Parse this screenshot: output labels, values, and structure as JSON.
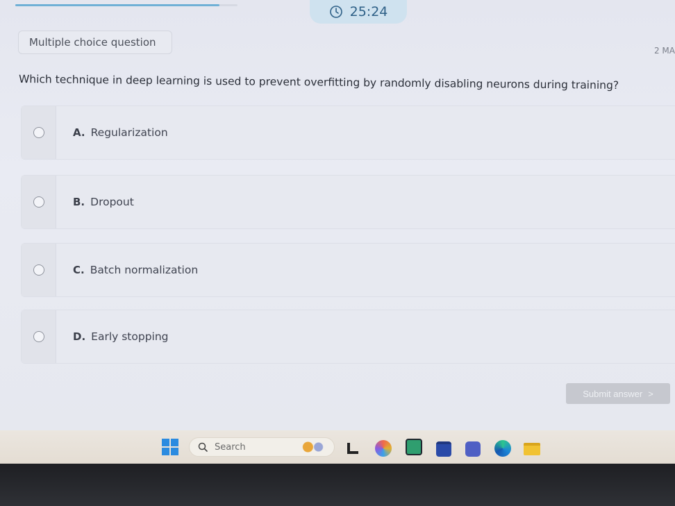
{
  "timer": {
    "text": "25:24",
    "icon": "clock-icon"
  },
  "progress": {
    "fraction": 0.92
  },
  "question_type": "Multiple choice question",
  "marks": "2 MA",
  "question": "Which technique in deep learning is used to prevent overfitting by randomly disabling neurons during training?",
  "options": [
    {
      "letter": "A.",
      "text": "Regularization"
    },
    {
      "letter": "B.",
      "text": "Dropout"
    },
    {
      "letter": "C.",
      "text": "Batch normalization"
    },
    {
      "letter": "D.",
      "text": "Early stopping"
    }
  ],
  "submit": {
    "label": "Submit answer",
    "chevron": ">"
  },
  "taskbar": {
    "search_placeholder": "Search",
    "icons": [
      "windows-start-icon",
      "search-icon",
      "widgets-icon",
      "task-view-icon",
      "copilot-icon",
      "photos-icon",
      "store-icon",
      "teams-icon",
      "edge-icon",
      "file-explorer-icon"
    ]
  },
  "colors": {
    "timer_bg": "#cfe2ef",
    "timer_text": "#2d5f86",
    "submit_bg": "#c6c8cf",
    "windows_blue": "#2b8be0"
  }
}
